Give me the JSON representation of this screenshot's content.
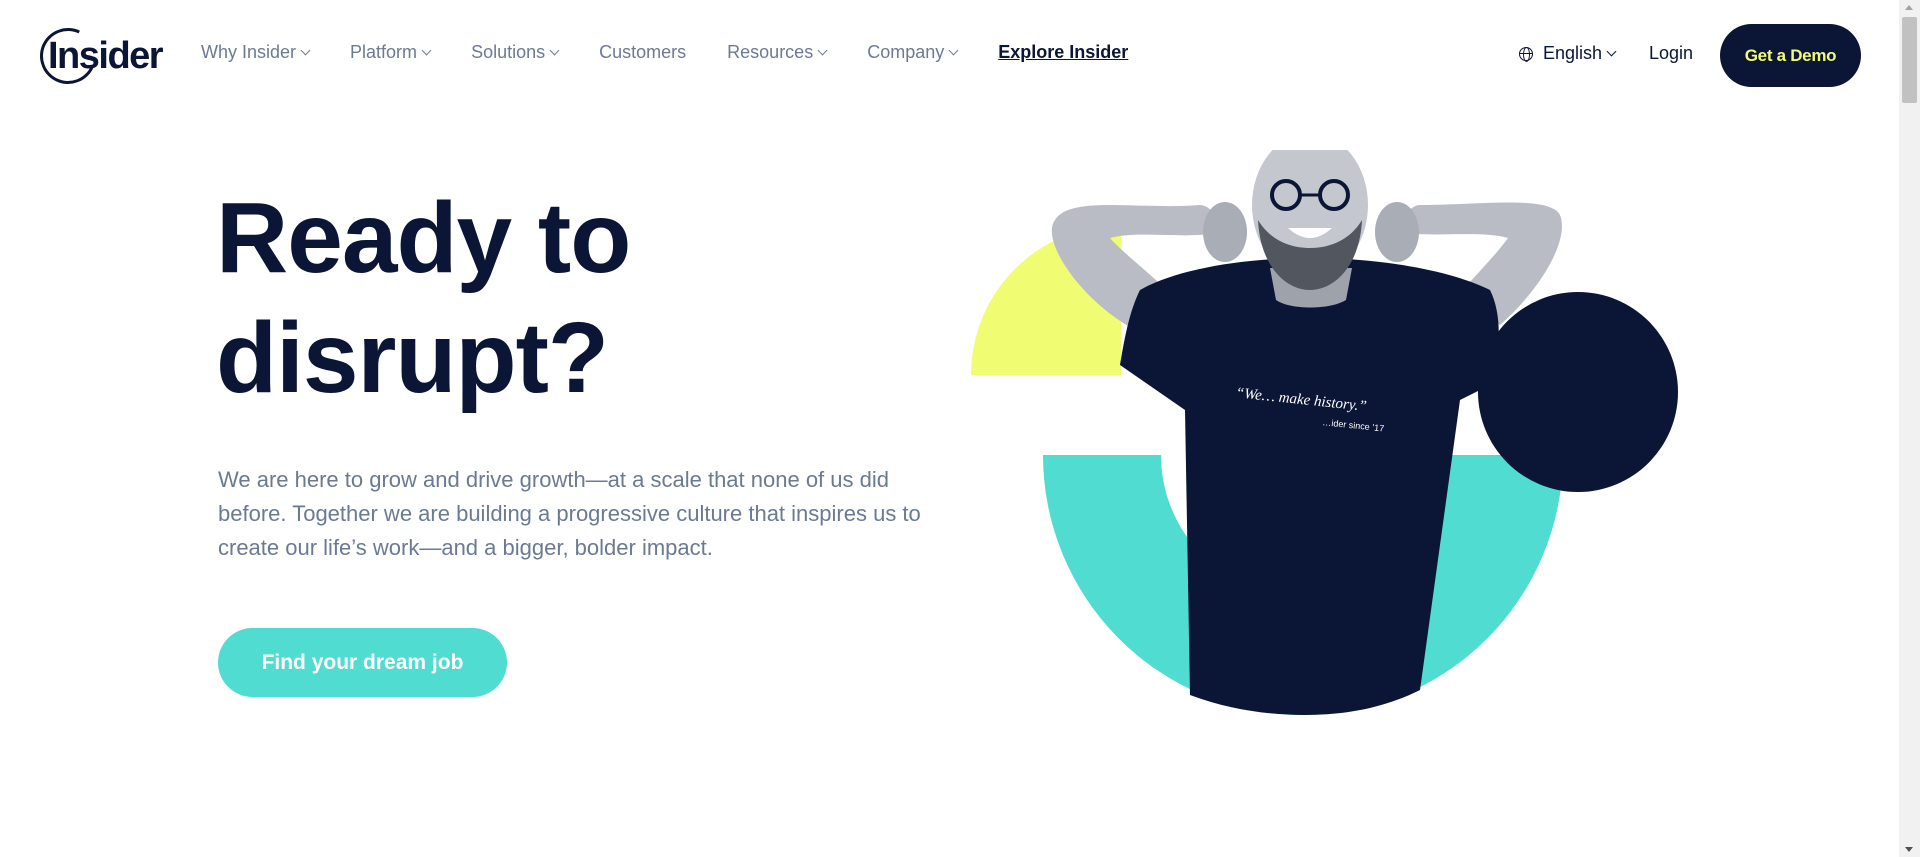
{
  "header": {
    "logo_text": "Insider",
    "nav": [
      {
        "label": "Why Insider",
        "has_dropdown": true
      },
      {
        "label": "Platform",
        "has_dropdown": true
      },
      {
        "label": "Solutions",
        "has_dropdown": true
      },
      {
        "label": "Customers",
        "has_dropdown": false
      },
      {
        "label": "Resources",
        "has_dropdown": true
      },
      {
        "label": "Company",
        "has_dropdown": true
      }
    ],
    "explore_label": "Explore Insider",
    "language_label": "English",
    "login_label": "Login",
    "demo_label": "Get a Demo"
  },
  "hero": {
    "headline_line1": "Ready to",
    "headline_line2": "disrupt?",
    "subtext": "We are here to grow and drive growth—at a scale that none of us did before. Together we are building a progressive culture that inspires us to create our life’s work—and a bigger, bolder impact.",
    "cta_label": "Find your dream job",
    "tshirt_text": "“We… make history.”",
    "tshirt_subtext": "…ider since ’17"
  },
  "colors": {
    "navy": "#0b1536",
    "teal": "#50dcd0",
    "yellow": "#f0fd72",
    "muted_text": "#6b7a93"
  }
}
